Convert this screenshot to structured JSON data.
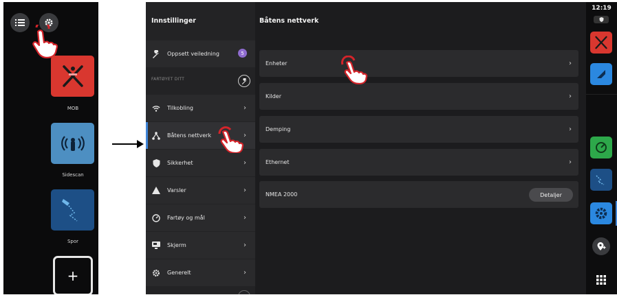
{
  "colors": {
    "accent_blue": "#3f84d6",
    "mob_red": "#d9372f",
    "sidescan_blue": "#4d8fc2",
    "spor_navy": "#1d4f86",
    "badge_purple": "#8f6ccf",
    "tap_red": "#d4242a"
  },
  "home": {
    "apps": [
      {
        "label": "MOB",
        "icon": "man-overboard-icon"
      },
      {
        "label": "Sidescan",
        "icon": "sidescan-sonar-icon"
      },
      {
        "label": "Spor",
        "icon": "track-icon"
      }
    ],
    "add_label": "+"
  },
  "settings": {
    "title": "Innstillinger",
    "onboarding": {
      "label": "Oppsett veiledning",
      "badge": "5"
    },
    "section_label": "FARTØYET DITT",
    "items": [
      {
        "label": "Tilkobling",
        "icon": "wifi-icon"
      },
      {
        "label": "Båtens nettverk",
        "icon": "network-icon"
      },
      {
        "label": "Sikkerhet",
        "icon": "shield-icon"
      },
      {
        "label": "Varsler",
        "icon": "warning-icon"
      },
      {
        "label": "Fartøy og mål",
        "icon": "gauge-icon"
      },
      {
        "label": "Skjerm",
        "icon": "display-icon"
      },
      {
        "label": "Generelt",
        "icon": "gear-icon"
      }
    ]
  },
  "network": {
    "title": "Båtens nettverk",
    "rows": [
      {
        "label": "Enheter"
      },
      {
        "label": "Kilder"
      },
      {
        "label": "Demping"
      },
      {
        "label": "Ethernet"
      }
    ],
    "nmea": {
      "label": "NMEA 2000",
      "button": "Detaljer"
    }
  },
  "dock": {
    "time": "12:19"
  }
}
